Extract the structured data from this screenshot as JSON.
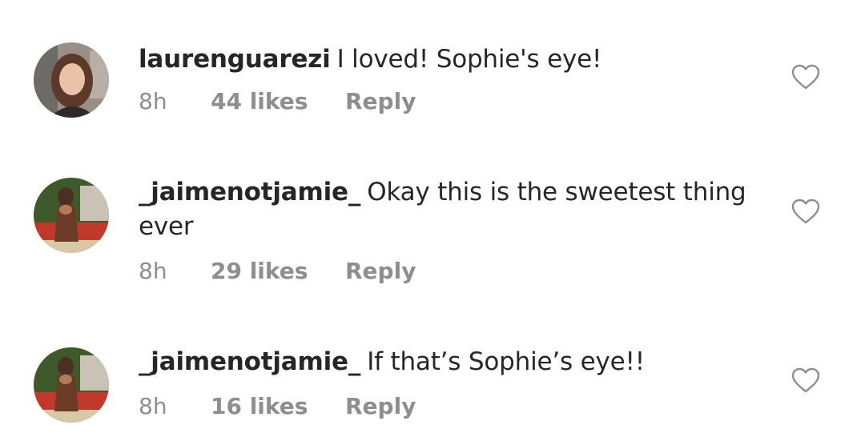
{
  "comments": [
    {
      "username": "laurenguarezi",
      "text": "I loved! Sophie's eye!",
      "time": "8h",
      "likes": "44 likes",
      "reply": "Reply",
      "avatar_icon": "profile-photo-woman",
      "like_icon": "heart-outline-icon"
    },
    {
      "username": "_jaimenotjamie_",
      "text": "Okay this is the sweetest thing ever",
      "time": "8h",
      "likes": "29 likes",
      "reply": "Reply",
      "avatar_icon": "profile-photo-outdoor",
      "like_icon": "heart-outline-icon"
    },
    {
      "username": "_jaimenotjamie_",
      "text": "If that’s Sophie’s eye!!",
      "time": "8h",
      "likes": "16 likes",
      "reply": "Reply",
      "avatar_icon": "profile-photo-outdoor",
      "like_icon": "heart-outline-icon"
    }
  ],
  "colors": {
    "text": "#262626",
    "secondary": "#8e8e8e",
    "icon": "#8e8e8e"
  }
}
